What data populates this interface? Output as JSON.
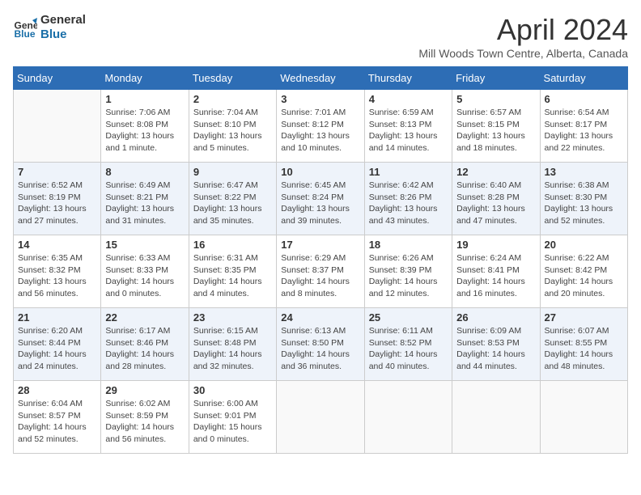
{
  "logo": {
    "line1": "General",
    "line2": "Blue"
  },
  "title": "April 2024",
  "subtitle": "Mill Woods Town Centre, Alberta, Canada",
  "days_of_week": [
    "Sunday",
    "Monday",
    "Tuesday",
    "Wednesday",
    "Thursday",
    "Friday",
    "Saturday"
  ],
  "weeks": [
    [
      {
        "day": "",
        "info": ""
      },
      {
        "day": "1",
        "info": "Sunrise: 7:06 AM\nSunset: 8:08 PM\nDaylight: 13 hours\nand 1 minute."
      },
      {
        "day": "2",
        "info": "Sunrise: 7:04 AM\nSunset: 8:10 PM\nDaylight: 13 hours\nand 5 minutes."
      },
      {
        "day": "3",
        "info": "Sunrise: 7:01 AM\nSunset: 8:12 PM\nDaylight: 13 hours\nand 10 minutes."
      },
      {
        "day": "4",
        "info": "Sunrise: 6:59 AM\nSunset: 8:13 PM\nDaylight: 13 hours\nand 14 minutes."
      },
      {
        "day": "5",
        "info": "Sunrise: 6:57 AM\nSunset: 8:15 PM\nDaylight: 13 hours\nand 18 minutes."
      },
      {
        "day": "6",
        "info": "Sunrise: 6:54 AM\nSunset: 8:17 PM\nDaylight: 13 hours\nand 22 minutes."
      }
    ],
    [
      {
        "day": "7",
        "info": "Sunrise: 6:52 AM\nSunset: 8:19 PM\nDaylight: 13 hours\nand 27 minutes."
      },
      {
        "day": "8",
        "info": "Sunrise: 6:49 AM\nSunset: 8:21 PM\nDaylight: 13 hours\nand 31 minutes."
      },
      {
        "day": "9",
        "info": "Sunrise: 6:47 AM\nSunset: 8:22 PM\nDaylight: 13 hours\nand 35 minutes."
      },
      {
        "day": "10",
        "info": "Sunrise: 6:45 AM\nSunset: 8:24 PM\nDaylight: 13 hours\nand 39 minutes."
      },
      {
        "day": "11",
        "info": "Sunrise: 6:42 AM\nSunset: 8:26 PM\nDaylight: 13 hours\nand 43 minutes."
      },
      {
        "day": "12",
        "info": "Sunrise: 6:40 AM\nSunset: 8:28 PM\nDaylight: 13 hours\nand 47 minutes."
      },
      {
        "day": "13",
        "info": "Sunrise: 6:38 AM\nSunset: 8:30 PM\nDaylight: 13 hours\nand 52 minutes."
      }
    ],
    [
      {
        "day": "14",
        "info": "Sunrise: 6:35 AM\nSunset: 8:32 PM\nDaylight: 13 hours\nand 56 minutes."
      },
      {
        "day": "15",
        "info": "Sunrise: 6:33 AM\nSunset: 8:33 PM\nDaylight: 14 hours\nand 0 minutes."
      },
      {
        "day": "16",
        "info": "Sunrise: 6:31 AM\nSunset: 8:35 PM\nDaylight: 14 hours\nand 4 minutes."
      },
      {
        "day": "17",
        "info": "Sunrise: 6:29 AM\nSunset: 8:37 PM\nDaylight: 14 hours\nand 8 minutes."
      },
      {
        "day": "18",
        "info": "Sunrise: 6:26 AM\nSunset: 8:39 PM\nDaylight: 14 hours\nand 12 minutes."
      },
      {
        "day": "19",
        "info": "Sunrise: 6:24 AM\nSunset: 8:41 PM\nDaylight: 14 hours\nand 16 minutes."
      },
      {
        "day": "20",
        "info": "Sunrise: 6:22 AM\nSunset: 8:42 PM\nDaylight: 14 hours\nand 20 minutes."
      }
    ],
    [
      {
        "day": "21",
        "info": "Sunrise: 6:20 AM\nSunset: 8:44 PM\nDaylight: 14 hours\nand 24 minutes."
      },
      {
        "day": "22",
        "info": "Sunrise: 6:17 AM\nSunset: 8:46 PM\nDaylight: 14 hours\nand 28 minutes."
      },
      {
        "day": "23",
        "info": "Sunrise: 6:15 AM\nSunset: 8:48 PM\nDaylight: 14 hours\nand 32 minutes."
      },
      {
        "day": "24",
        "info": "Sunrise: 6:13 AM\nSunset: 8:50 PM\nDaylight: 14 hours\nand 36 minutes."
      },
      {
        "day": "25",
        "info": "Sunrise: 6:11 AM\nSunset: 8:52 PM\nDaylight: 14 hours\nand 40 minutes."
      },
      {
        "day": "26",
        "info": "Sunrise: 6:09 AM\nSunset: 8:53 PM\nDaylight: 14 hours\nand 44 minutes."
      },
      {
        "day": "27",
        "info": "Sunrise: 6:07 AM\nSunset: 8:55 PM\nDaylight: 14 hours\nand 48 minutes."
      }
    ],
    [
      {
        "day": "28",
        "info": "Sunrise: 6:04 AM\nSunset: 8:57 PM\nDaylight: 14 hours\nand 52 minutes."
      },
      {
        "day": "29",
        "info": "Sunrise: 6:02 AM\nSunset: 8:59 PM\nDaylight: 14 hours\nand 56 minutes."
      },
      {
        "day": "30",
        "info": "Sunrise: 6:00 AM\nSunset: 9:01 PM\nDaylight: 15 hours\nand 0 minutes."
      },
      {
        "day": "",
        "info": ""
      },
      {
        "day": "",
        "info": ""
      },
      {
        "day": "",
        "info": ""
      },
      {
        "day": "",
        "info": ""
      }
    ]
  ]
}
